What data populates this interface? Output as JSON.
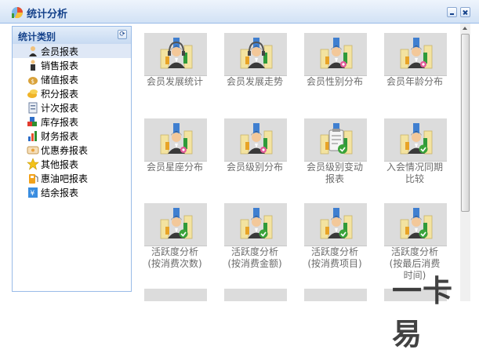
{
  "window": {
    "title": "统计分析"
  },
  "left_panel": {
    "title": "统计类别",
    "items": [
      {
        "label": "会员报表",
        "icon": "member-icon",
        "selected": true
      },
      {
        "label": "销售报表",
        "icon": "sales-icon",
        "selected": false
      },
      {
        "label": "储值报表",
        "icon": "money-bag-icon",
        "selected": false
      },
      {
        "label": "积分报表",
        "icon": "points-coins-icon",
        "selected": false
      },
      {
        "label": "计次报表",
        "icon": "count-sheet-icon",
        "selected": false
      },
      {
        "label": "库存报表",
        "icon": "stock-cubes-icon",
        "selected": false
      },
      {
        "label": "财务报表",
        "icon": "finance-chart-icon",
        "selected": false
      },
      {
        "label": "优惠券报表",
        "icon": "coupon-icon",
        "selected": false
      },
      {
        "label": "其他报表",
        "icon": "star-icon",
        "selected": false
      },
      {
        "label": "惠油吧报表",
        "icon": "fuel-icon",
        "selected": false
      },
      {
        "label": "结余报表",
        "icon": "balance-icon",
        "selected": false
      }
    ]
  },
  "reports": [
    {
      "label": "会员发展统计",
      "icon": "headset-chart-icon"
    },
    {
      "label": "会员发展走势",
      "icon": "headset-chart-icon"
    },
    {
      "label": "会员性别分布",
      "icon": "member-chart-icon"
    },
    {
      "label": "会员年龄分布",
      "icon": "member-chart-icon"
    },
    {
      "label": "会员星座分布",
      "icon": "member-chart-icon"
    },
    {
      "label": "会员级别分布",
      "icon": "member-chart-icon"
    },
    {
      "label": "会员级别变动\n报表",
      "icon": "clipboard-chart-icon"
    },
    {
      "label": "入会情况同期\n比较",
      "icon": "member-chart-check-icon"
    },
    {
      "label": "活跃度分析\n(按消费次数)",
      "icon": "member-chart-check-icon"
    },
    {
      "label": "活跃度分析\n(按消费金额)",
      "icon": "member-chart-check-icon"
    },
    {
      "label": "活跃度分析\n(按消费项目)",
      "icon": "member-chart-check-icon"
    },
    {
      "label": "活跃度分析\n(按最后消费\n时间)",
      "icon": "member-chart-check-icon"
    }
  ],
  "watermark": "一卡易",
  "colors": {
    "header_text": "#15428b",
    "border": "#99bbe8",
    "selected_bg": "#dfe8f6",
    "tile_bg": "#dcdcdc",
    "tile_text": "#6b6b6b"
  }
}
